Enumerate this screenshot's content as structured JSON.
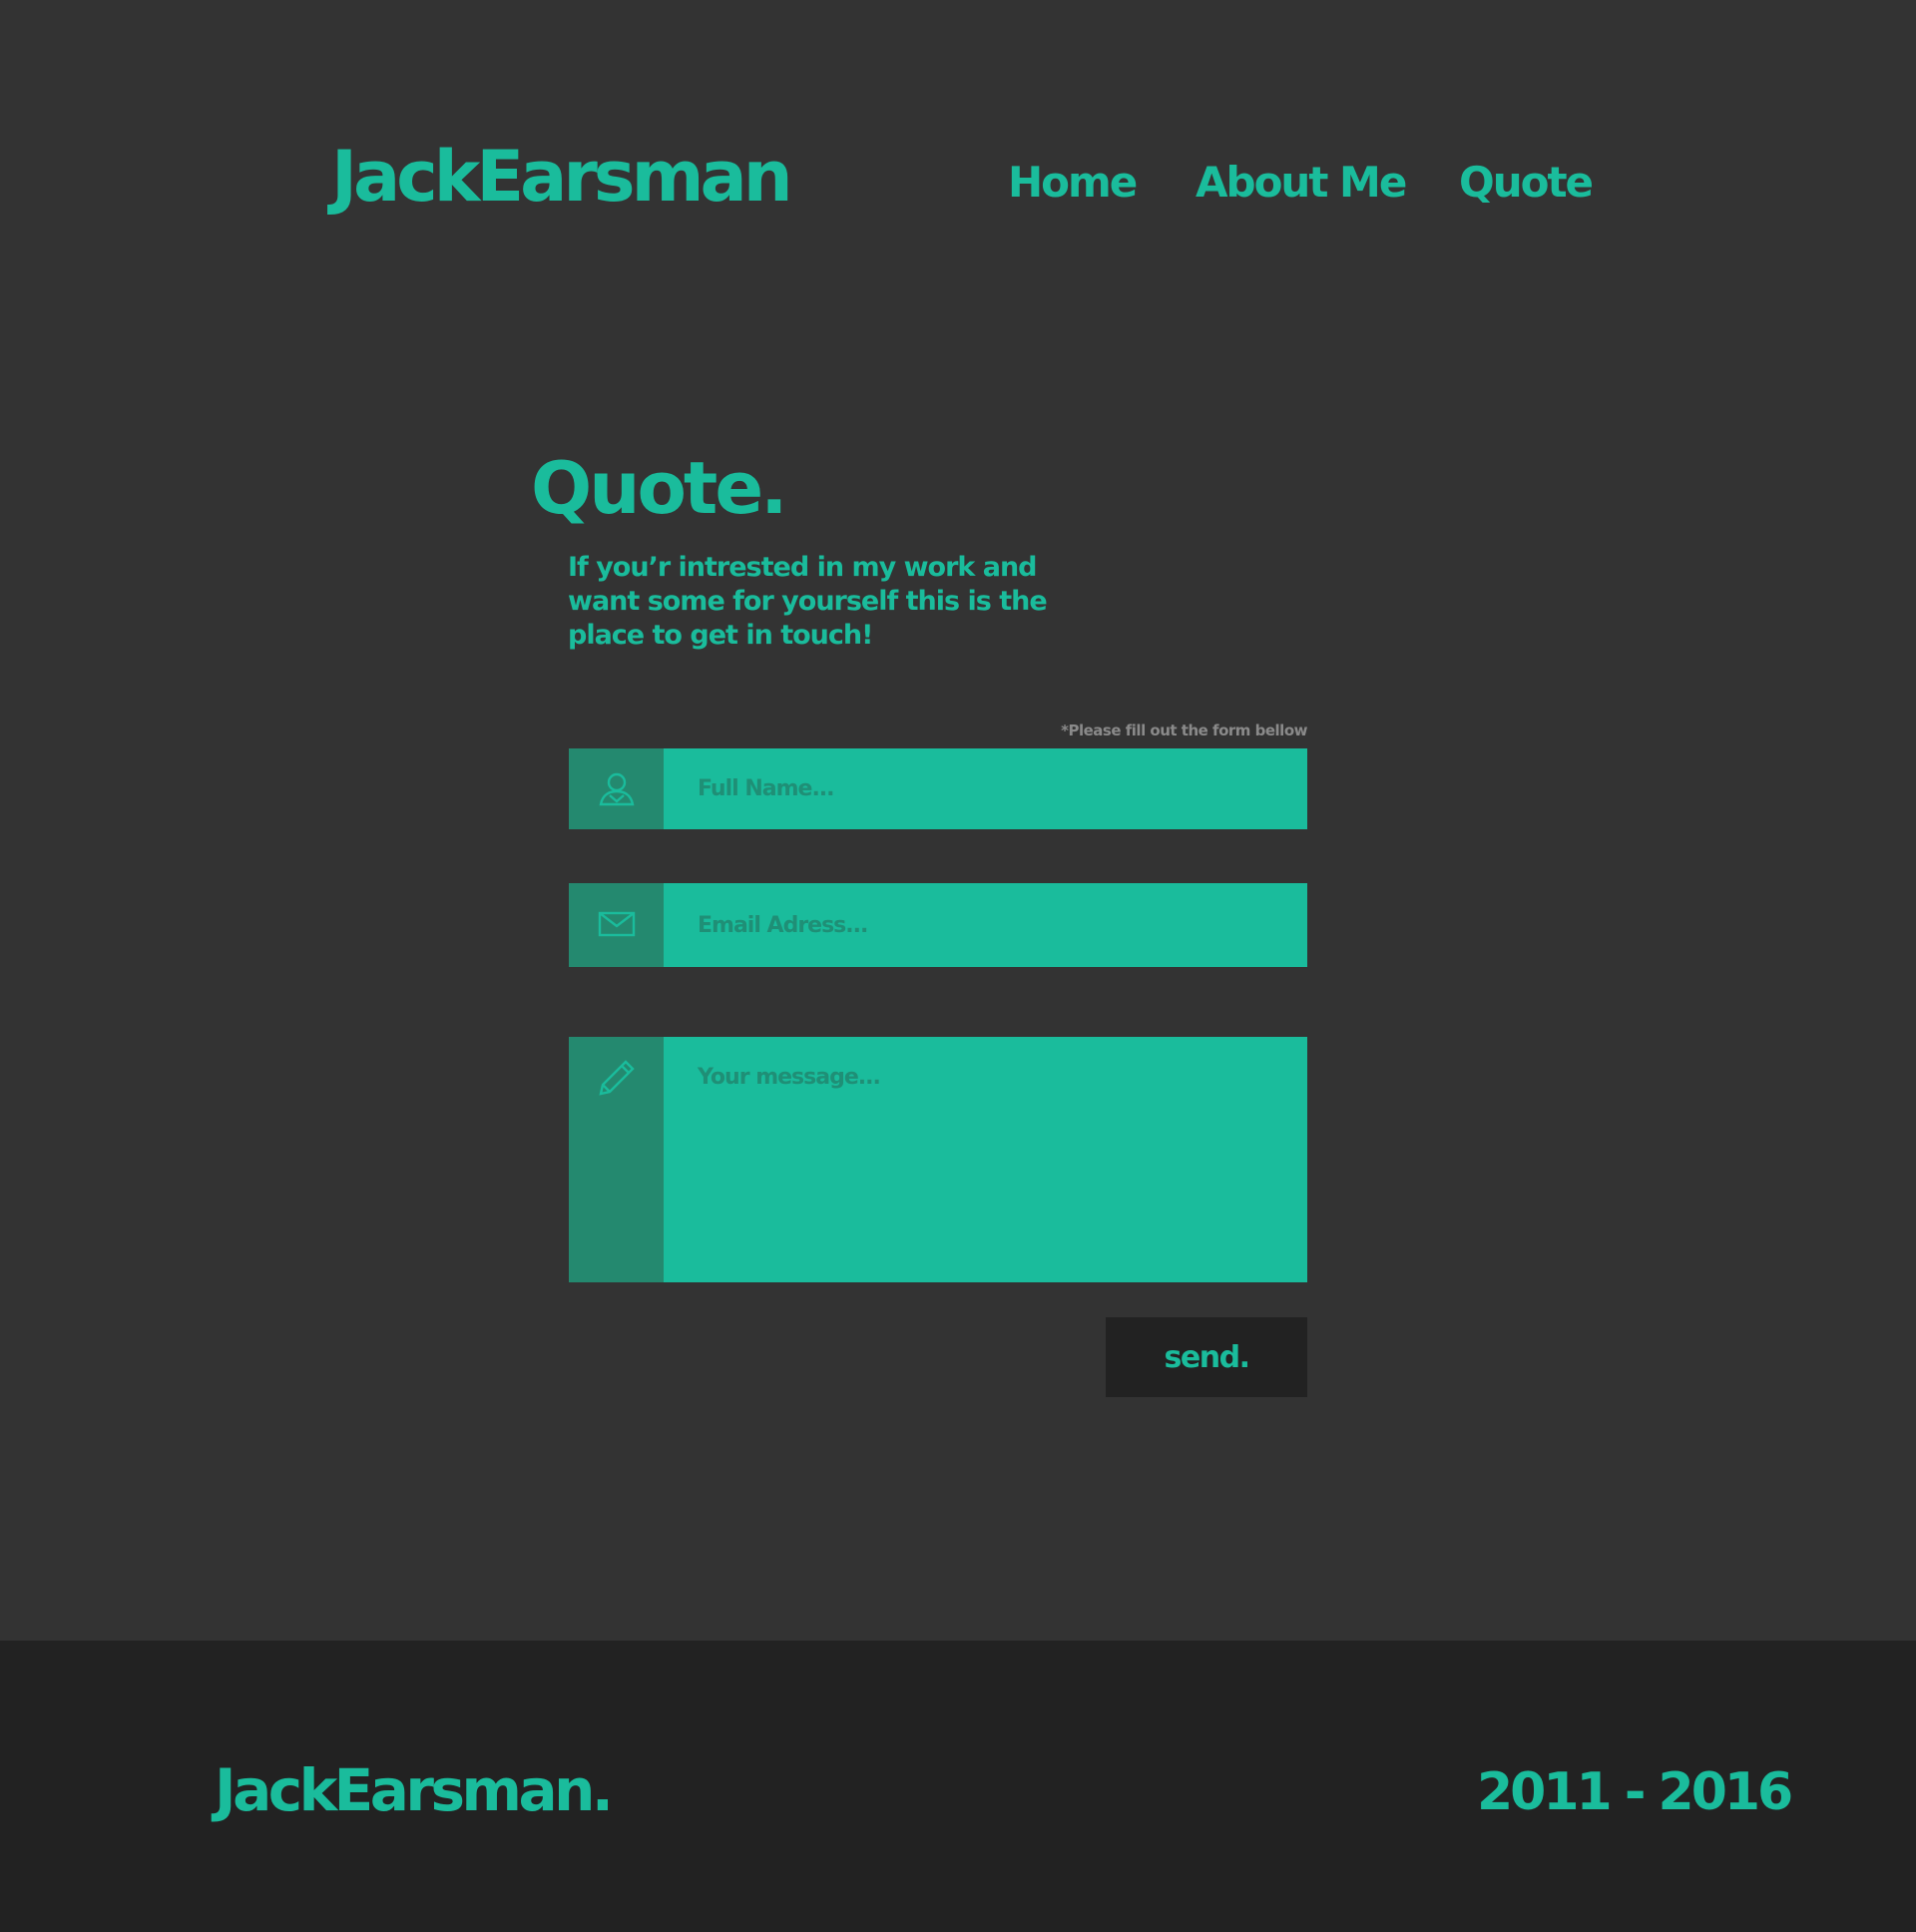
{
  "header": {
    "logo": "JackEarsman",
    "nav": [
      {
        "label": "Home"
      },
      {
        "label": "About Me"
      },
      {
        "label": "Quote"
      }
    ]
  },
  "main": {
    "title": "Quote.",
    "intro": "If you’r intrested in my work and want some for yourself this is the place to get in touch!",
    "form_note": "*Please fill out the form bellow",
    "fields": {
      "name": {
        "placeholder": "Full Name...",
        "value": "",
        "icon": "user-icon"
      },
      "email": {
        "placeholder": "Email Adress...",
        "value": "",
        "icon": "envelope-icon"
      },
      "message": {
        "placeholder": "Your message...",
        "value": "",
        "icon": "pencil-icon"
      }
    },
    "send_label": "send."
  },
  "footer": {
    "logo": "JackEarsman.",
    "years": "2011 - 2016"
  },
  "colors": {
    "background": "#333333",
    "accent": "#1abc9c",
    "icon_panel": "#24896f",
    "footer_bg": "#222222",
    "button_bg": "#222222",
    "note_text": "#8a8a8a"
  }
}
